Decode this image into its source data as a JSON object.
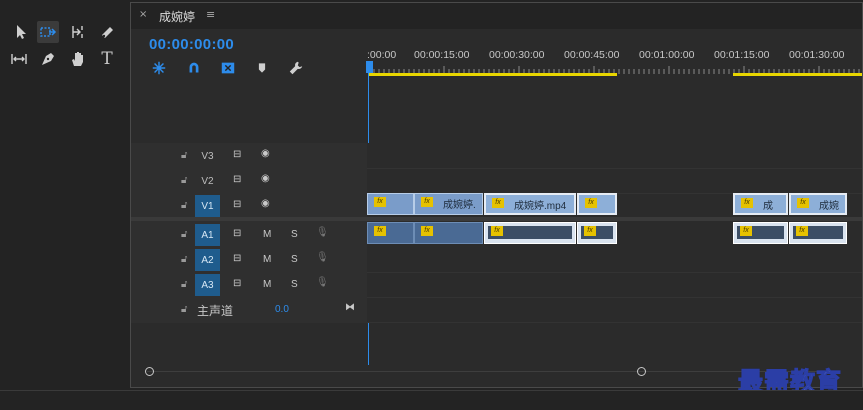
{
  "tools": [
    {
      "name": "selection-tool-icon",
      "glyph": "▲"
    },
    {
      "name": "track-select-tool-icon",
      "glyph": "⇥"
    },
    {
      "name": "ripple-edit-tool-icon",
      "glyph": "⇆"
    },
    {
      "name": "razor-tool-icon",
      "glyph": "◆"
    },
    {
      "name": "slip-tool-icon",
      "glyph": "|↔|"
    },
    {
      "name": "pen-tool-icon",
      "glyph": "✒"
    },
    {
      "name": "hand-tool-icon",
      "glyph": "✋"
    },
    {
      "name": "type-tool-icon",
      "glyph": "T"
    }
  ],
  "sequence": {
    "tab_close": "×",
    "title": "成婉婷",
    "tab_menu": "≡",
    "timecode": "00:00:00:00"
  },
  "ruler_labels": [
    ":00:00",
    "00:00:15:00",
    "00:00:30:00",
    "00:00:45:00",
    "00:01:00:00",
    "00:01:15:00",
    "00:01:30:00"
  ],
  "video_tracks": [
    {
      "label": "V3",
      "selected": false
    },
    {
      "label": "V2",
      "selected": false
    },
    {
      "label": "V1",
      "selected": true
    }
  ],
  "audio_tracks": [
    {
      "label": "A1",
      "mute": "M",
      "solo": "S"
    },
    {
      "label": "A2",
      "mute": "M",
      "solo": "S"
    },
    {
      "label": "A3",
      "mute": "M",
      "solo": "S"
    }
  ],
  "master": {
    "label": "主声道",
    "value": "0.0"
  },
  "clips": {
    "v1": [
      {
        "fx": "fx",
        "name": ""
      },
      {
        "fx": "fx",
        "name": "成婉婷."
      },
      {
        "fx": "fx",
        "name": "成婉婷.mp4"
      },
      {
        "fx": "fx",
        "name": ""
      },
      {
        "fx": "fx",
        "name": "成"
      },
      {
        "fx": "fx",
        "name": "成婉"
      }
    ],
    "a1": [
      {
        "fx": "fx"
      },
      {
        "fx": "fx"
      },
      {
        "fx": "fx"
      },
      {
        "fx": "fx"
      },
      {
        "fx": "fx"
      },
      {
        "fx": "fx"
      }
    ]
  },
  "watermark": "最需教育",
  "colors": {
    "accent": "#2d8ceb",
    "video_clip": "#8dafd8",
    "audio_clip": "#d9e3ef",
    "track_selected": "#1f5c8d",
    "work_area": "#e8d500"
  }
}
